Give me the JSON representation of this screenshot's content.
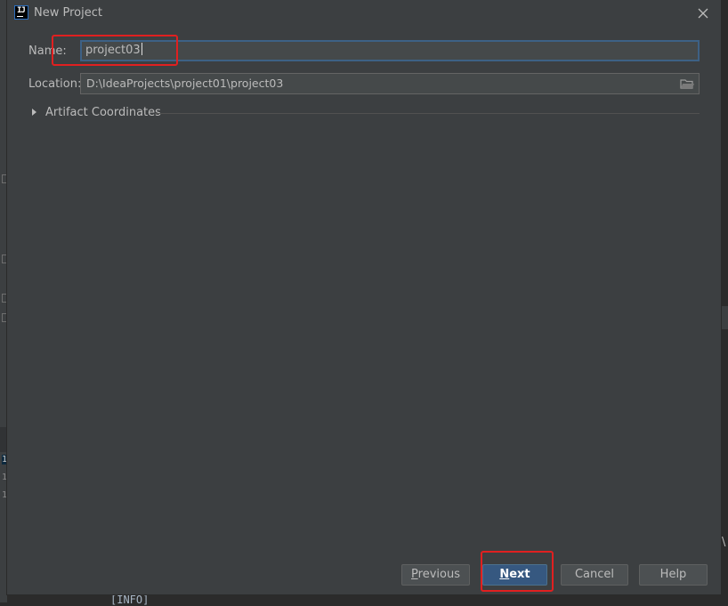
{
  "background": {
    "line_numbers": [
      "1",
      "1",
      "1"
    ],
    "console_text": "[INFO]",
    "right_glyph": "\\"
  },
  "dialog": {
    "title": "New Project",
    "name_label": "Name:",
    "name_value": "project03",
    "location_label": "Location:",
    "location_value": "D:\\IdeaProjects\\project01\\project03",
    "artifact_label": "Artifact Coordinates",
    "buttons": {
      "previous_first": "P",
      "previous_rest": "revious",
      "next_first": "N",
      "next_rest": "ext",
      "cancel": "Cancel",
      "help": "Help"
    }
  },
  "icons": [
    "intellij-app-icon",
    "close-icon",
    "folder-icon",
    "expand-triangle-icon"
  ],
  "colors": {
    "dialog_bg": "#3c3f41",
    "input_bg": "#45494a",
    "focus_border": "#3d6185",
    "primary_button": "#365880",
    "annotation_red": "#e02020"
  }
}
